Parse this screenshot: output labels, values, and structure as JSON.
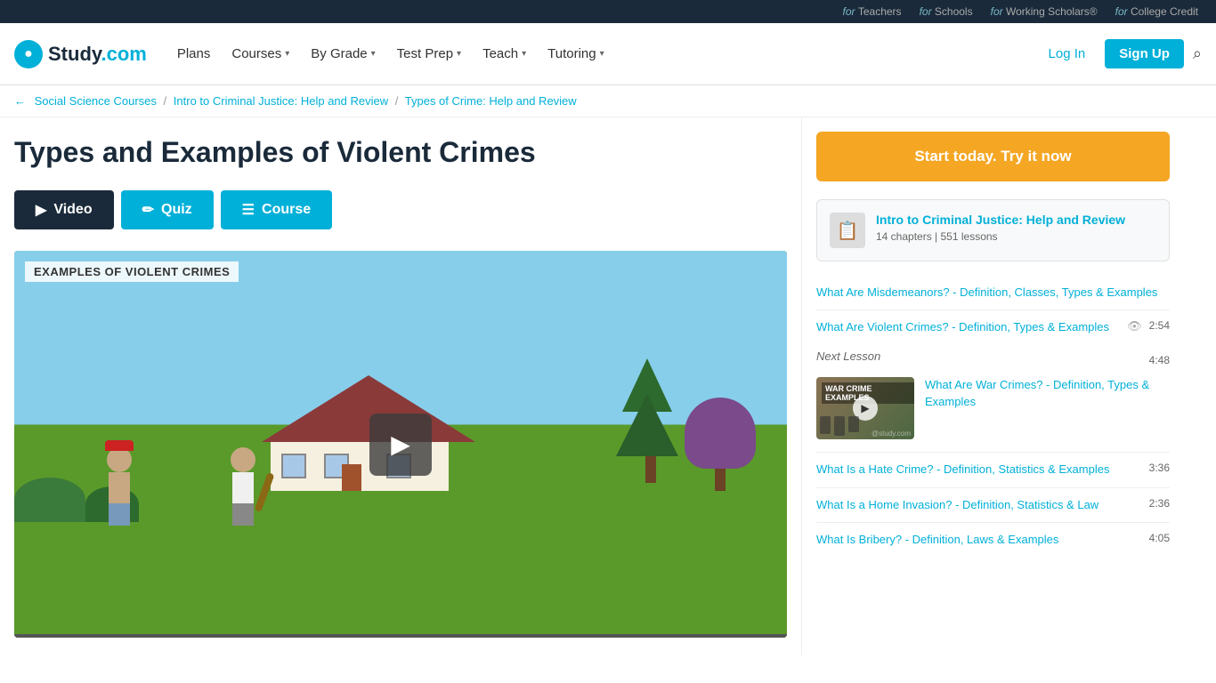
{
  "topbar": {
    "links": [
      {
        "label": "Teachers",
        "prefix": "for"
      },
      {
        "label": "Schools",
        "prefix": "for"
      },
      {
        "label": "Working Scholars®",
        "prefix": "for"
      },
      {
        "label": "College Credit",
        "prefix": "for"
      }
    ]
  },
  "nav": {
    "logo_circle": "●",
    "logo_name": "Study",
    "logo_dot": ".",
    "logo_com": "com",
    "links": [
      {
        "label": "Plans",
        "has_dropdown": false
      },
      {
        "label": "Courses",
        "has_dropdown": true
      },
      {
        "label": "By Grade",
        "has_dropdown": true
      },
      {
        "label": "Test Prep",
        "has_dropdown": true
      },
      {
        "label": "Teach",
        "has_dropdown": true
      },
      {
        "label": "Tutoring",
        "has_dropdown": true
      }
    ],
    "login_label": "Log In",
    "signup_label": "Sign Up"
  },
  "breadcrumb": {
    "arrow": "←",
    "items": [
      {
        "label": "Social Science Courses",
        "href": "#"
      },
      {
        "label": "Intro to Criminal Justice: Help and Review",
        "href": "#"
      },
      {
        "label": "Types of Crime: Help and Review",
        "href": "#"
      }
    ]
  },
  "page": {
    "title": "Types and Examples of Violent Crimes"
  },
  "tabs": {
    "video": {
      "icon": "▶",
      "label": "Video"
    },
    "quiz": {
      "icon": "✏",
      "label": "Quiz"
    },
    "course": {
      "icon": "☰",
      "label": "Course"
    }
  },
  "video": {
    "title_overlay": "EXAMPLES OF VIOLENT CRIMES",
    "progress_pct": 0
  },
  "sidebar": {
    "cta_label": "Start today. Try it now",
    "course_card": {
      "title": "Intro to Criminal Justice: Help and Review",
      "meta": "14 chapters | 551 lessons"
    },
    "lessons": [
      {
        "label": "What Are Misdemeanors? - Definition, Classes, Types & Examples",
        "duration": "",
        "icon": "",
        "is_active": false
      },
      {
        "label": "What Are Violent Crimes? - Definition, Types & Examples",
        "duration": "2:54",
        "icon": "👁",
        "is_active": false
      }
    ],
    "next_lesson": {
      "label": "Next Lesson",
      "duration": "4:48",
      "thumb_label": "WAR CRIME EXAMPLES",
      "title": "What Are War Crimes? - Definition, Types & Examples"
    },
    "more_lessons": [
      {
        "label": "What Is a Hate Crime? - Definition, Statistics & Examples",
        "duration": "3:36"
      },
      {
        "label": "What Is a Home Invasion? - Definition, Statistics & Law",
        "duration": "2:36"
      },
      {
        "label": "What Is Bribery? - Definition, Laws & Examples",
        "duration": "4:05"
      }
    ]
  }
}
